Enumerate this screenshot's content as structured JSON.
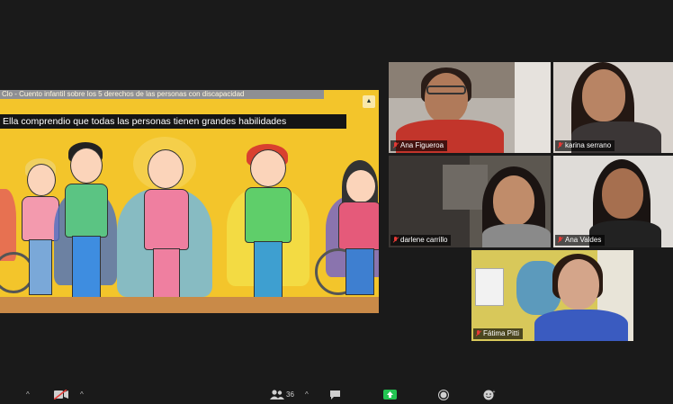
{
  "shared_screen": {
    "title_bar": "Clo - Cuento infantil sobre los 5 derechos de las personas con discapacidad",
    "caption": "Ella comprendio que todas las personas tienen grandes habilidades"
  },
  "participants": [
    {
      "name": "Ana Figueroa",
      "muted": true
    },
    {
      "name": "karina serrano",
      "muted": true
    },
    {
      "name": "darlene carrillo",
      "muted": true
    },
    {
      "name": "Ana Valdes",
      "muted": true
    },
    {
      "name": "Fátima Pitti",
      "muted": true
    }
  ],
  "toolbar": {
    "participants_count": "36"
  },
  "icons": {
    "mute": "microphone-icon",
    "video": "video-off-icon",
    "participants": "participants-icon",
    "chat": "chat-icon",
    "share": "share-screen-icon",
    "record": "record-icon",
    "reactions": "reactions-icon"
  },
  "colors": {
    "background": "#1a1a1a",
    "mic_off": "#e53935",
    "share_green": "#23c552"
  }
}
